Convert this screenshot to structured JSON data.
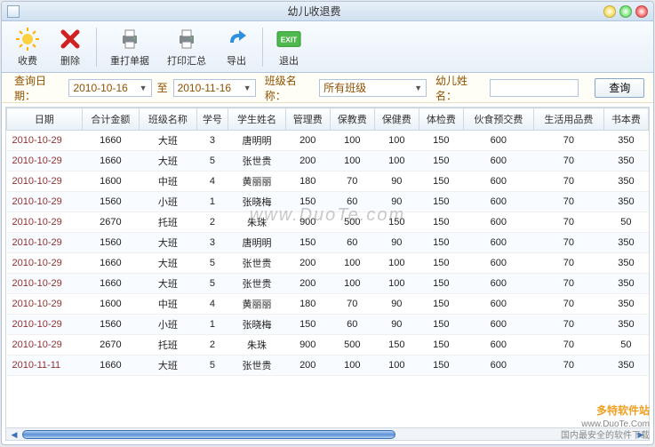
{
  "window": {
    "title": "幼儿收退费"
  },
  "toolbar": {
    "fee": "收费",
    "delete": "删除",
    "reprint": "重打单据",
    "printsum": "打印汇总",
    "export": "导出",
    "exit": "退出"
  },
  "filter": {
    "date_label": "查询日期：",
    "date_from": "2010-10-16",
    "date_to_word": "至",
    "date_to": "2010-11-16",
    "class_label": "班级名称：",
    "class_value": "所有班级",
    "name_label": "幼儿姓名：",
    "name_value": "",
    "query": "查询"
  },
  "columns": [
    "日期",
    "合计金额",
    "班级名称",
    "学号",
    "学生姓名",
    "管理费",
    "保教费",
    "保健费",
    "体检费",
    "伙食预交费",
    "生活用品费",
    "书本费"
  ],
  "rows": [
    [
      "2010-10-29",
      "1660",
      "大班",
      "3",
      "唐明明",
      "200",
      "100",
      "100",
      "150",
      "600",
      "70",
      "350"
    ],
    [
      "2010-10-29",
      "1660",
      "大班",
      "5",
      "张世贵",
      "200",
      "100",
      "100",
      "150",
      "600",
      "70",
      "350"
    ],
    [
      "2010-10-29",
      "1600",
      "中班",
      "4",
      "黄丽丽",
      "180",
      "70",
      "90",
      "150",
      "600",
      "70",
      "350"
    ],
    [
      "2010-10-29",
      "1560",
      "小班",
      "1",
      "张晓梅",
      "150",
      "60",
      "90",
      "150",
      "600",
      "70",
      "350"
    ],
    [
      "2010-10-29",
      "2670",
      "托班",
      "2",
      "朱珠",
      "900",
      "500",
      "150",
      "150",
      "600",
      "70",
      "50"
    ],
    [
      "2010-10-29",
      "1560",
      "大班",
      "3",
      "唐明明",
      "150",
      "60",
      "90",
      "150",
      "600",
      "70",
      "350"
    ],
    [
      "2010-10-29",
      "1660",
      "大班",
      "5",
      "张世贵",
      "200",
      "100",
      "100",
      "150",
      "600",
      "70",
      "350"
    ],
    [
      "2010-10-29",
      "1660",
      "大班",
      "5",
      "张世贵",
      "200",
      "100",
      "100",
      "150",
      "600",
      "70",
      "350"
    ],
    [
      "2010-10-29",
      "1600",
      "中班",
      "4",
      "黄丽丽",
      "180",
      "70",
      "90",
      "150",
      "600",
      "70",
      "350"
    ],
    [
      "2010-10-29",
      "1560",
      "小班",
      "1",
      "张晓梅",
      "150",
      "60",
      "90",
      "150",
      "600",
      "70",
      "350"
    ],
    [
      "2010-10-29",
      "2670",
      "托班",
      "2",
      "朱珠",
      "900",
      "500",
      "150",
      "150",
      "600",
      "70",
      "50"
    ],
    [
      "2010-11-11",
      "1660",
      "大班",
      "5",
      "张世贵",
      "200",
      "100",
      "100",
      "150",
      "600",
      "70",
      "350"
    ]
  ],
  "watermark": {
    "brand": "多特软件站",
    "url": "www.DuoTe.Com",
    "tagline": "国内最安全的软件下载",
    "center": "www.DuoTe.com"
  }
}
